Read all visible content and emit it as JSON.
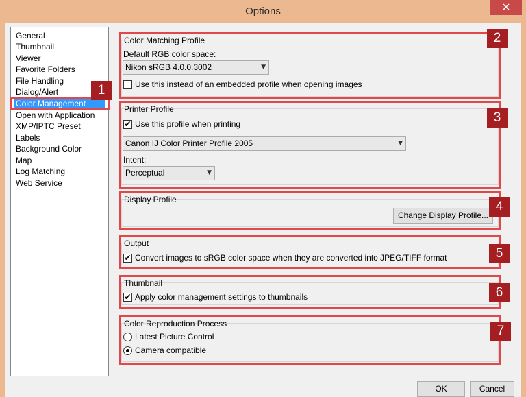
{
  "window": {
    "title": "Options",
    "close_glyph": "✕"
  },
  "nav": {
    "items": [
      {
        "label": "General"
      },
      {
        "label": "Thumbnail"
      },
      {
        "label": "Viewer"
      },
      {
        "label": "Favorite Folders"
      },
      {
        "label": "File Handling"
      },
      {
        "label": "Dialog/Alert"
      },
      {
        "label": "Color Management",
        "selected": true
      },
      {
        "label": "Open with Application"
      },
      {
        "label": "XMP/IPTC Preset"
      },
      {
        "label": "Labels"
      },
      {
        "label": "Background Color"
      },
      {
        "label": "Map"
      },
      {
        "label": "Log Matching"
      },
      {
        "label": "Web Service"
      }
    ]
  },
  "color_matching": {
    "title": "Color Matching Profile",
    "rgb_label": "Default RGB color space:",
    "rgb_value": "Nikon sRGB 4.0.0.3002",
    "embedded_label": "Use this instead of an embedded profile when opening images",
    "embedded_checked": false
  },
  "printer": {
    "title": "Printer Profile",
    "use_label": "Use this profile when printing",
    "use_checked": true,
    "profile_value": "Canon IJ Color Printer Profile 2005",
    "intent_label": "Intent:",
    "intent_value": "Perceptual"
  },
  "display": {
    "title": "Display Profile",
    "change_button": "Change Display Profile..."
  },
  "output": {
    "title": "Output",
    "convert_label": "Convert images to sRGB color space when they are converted into JPEG/TIFF format",
    "convert_checked": true
  },
  "thumbnail": {
    "title": "Thumbnail",
    "apply_label": "Apply color management settings to thumbnails",
    "apply_checked": true
  },
  "reproduction": {
    "title": "Color Reproduction Process",
    "options": [
      {
        "label": "Latest Picture Control",
        "selected": false
      },
      {
        "label": "Camera compatible",
        "selected": true
      }
    ]
  },
  "footer": {
    "ok": "OK",
    "cancel": "Cancel"
  },
  "annotations": {
    "badge_1": "1",
    "badge_2": "2",
    "badge_3": "3",
    "badge_4": "4",
    "badge_5": "5",
    "badge_6": "6",
    "badge_7": "7",
    "highlight_color": "#e0484a",
    "badge_color": "#a51e21"
  },
  "glyphs": {
    "check": "✔",
    "dropdown": "▼"
  }
}
